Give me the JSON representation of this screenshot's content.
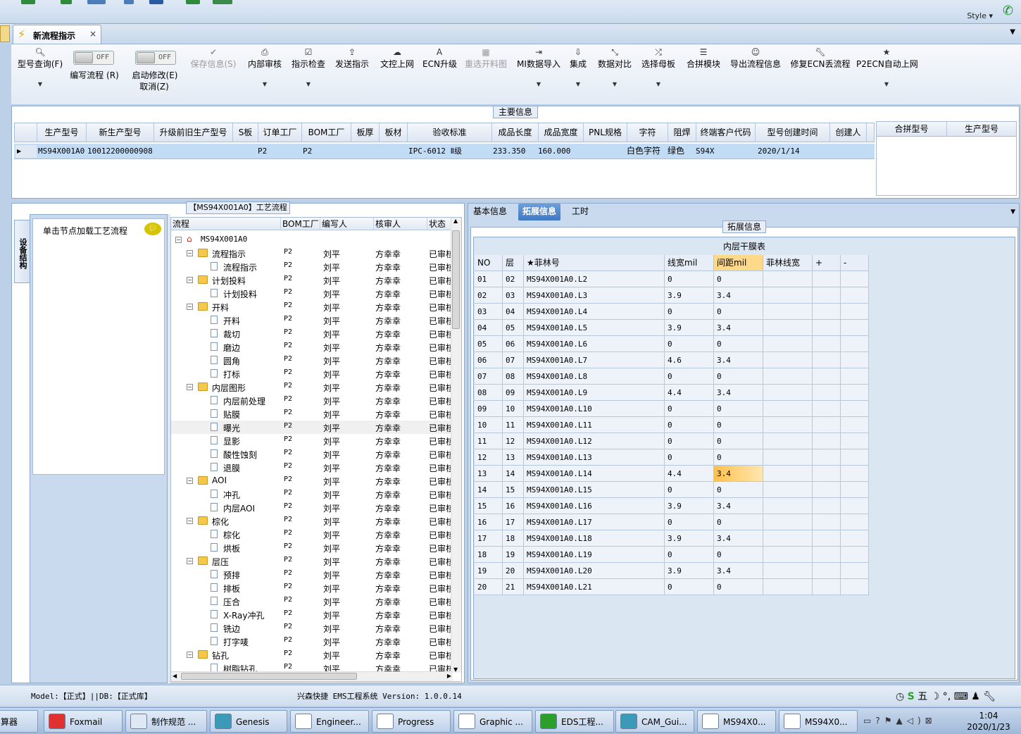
{
  "top": {
    "style_label": "Style"
  },
  "tab": {
    "title": "新流程指示",
    "close": "×"
  },
  "toolbar": {
    "items": [
      {
        "label": "型号查询(F)",
        "icon": "search-icon",
        "glyph": "🔍︎"
      },
      {
        "label": "编写流程 (R)",
        "icon": "toggle"
      },
      {
        "label": "启动修改(E)",
        "icon": "toggle"
      },
      {
        "label": "保存信息(S)",
        "icon": "check-icon",
        "glyph": "✔"
      },
      {
        "label": "内部审核",
        "icon": "printer-icon",
        "glyph": "⎙"
      },
      {
        "label": "指示检查",
        "icon": "checkbox-icon",
        "glyph": "☑"
      },
      {
        "label": "发送指示",
        "icon": "upload-icon",
        "glyph": "⇪"
      },
      {
        "label": "文控上网",
        "icon": "cloud-icon",
        "glyph": "☁"
      },
      {
        "label": "ECN升级",
        "icon": "font-icon",
        "glyph": "A"
      },
      {
        "label": "重选开料图",
        "icon": "image-icon",
        "glyph": "▦"
      },
      {
        "label": "MI数据导入",
        "icon": "import-icon",
        "glyph": "⇥"
      },
      {
        "label": "集成",
        "icon": "download-icon",
        "glyph": "⇩"
      },
      {
        "label": "数据对比",
        "icon": "compress-icon",
        "glyph": "⤡"
      },
      {
        "label": "选择母板",
        "icon": "shuffle-icon",
        "glyph": "⤮"
      },
      {
        "label": "合拼模块",
        "icon": "list-icon",
        "glyph": "☰"
      },
      {
        "label": "导出流程信息",
        "icon": "smile-icon",
        "glyph": "☺"
      },
      {
        "label": "修复ECN丢流程",
        "icon": "wrench-icon",
        "glyph": "🔧︎"
      },
      {
        "label": "P2ECN自动上网",
        "icon": "star-icon",
        "glyph": "★"
      }
    ],
    "toggle_off": "OFF",
    "cancel_label": "取消(Z)"
  },
  "main_info": {
    "title": "主要信息",
    "columns": [
      "生产型号",
      "新生产型号",
      "升级前旧生产型号",
      "S板",
      "订单工厂",
      "BOM工厂",
      "板厚",
      "板材",
      "验收标准",
      "成品长度",
      "成品宽度",
      "PNL规格",
      "字符",
      "阻焊",
      "终端客户代码",
      "型号创建时间",
      "创建人"
    ],
    "row": {
      "生产型号": "MS94X001A0",
      "新生产型号": "10012200000908",
      "订单工厂": "P2",
      "BOM工厂": "P2",
      "验收标准": "IPC-6012 Ⅱ级",
      "成品长度": "233.350",
      "成品宽度": "160.000",
      "字符": "白色字符",
      "阻焊": "绿色",
      "终端客户代码": "S94X",
      "型号创建时间": "2020/1/14"
    },
    "merge_columns": [
      "合拼型号",
      "生产型号"
    ]
  },
  "left_panel": {
    "title": "【MS94X001A0】工艺流程",
    "vertical_tab": "设备结构",
    "load_hint": "单击节点加载工艺流程",
    "tree_columns": [
      "流程",
      "BOM工厂",
      "编写人",
      "核审人",
      "状态"
    ],
    "root": "MS94X001A0",
    "rows": [
      {
        "name": "流程指示",
        "lvl": 1
      },
      {
        "name": "流程指示",
        "lvl": 2
      },
      {
        "name": "计划投料",
        "lvl": 1
      },
      {
        "name": "计划投料",
        "lvl": 2
      },
      {
        "name": "开料",
        "lvl": 1
      },
      {
        "name": "开料",
        "lvl": 2
      },
      {
        "name": "裁切",
        "lvl": 2
      },
      {
        "name": "磨边",
        "lvl": 2
      },
      {
        "name": "圆角",
        "lvl": 2
      },
      {
        "name": "打标",
        "lvl": 2
      },
      {
        "name": "内层图形",
        "lvl": 1
      },
      {
        "name": "内层前处理",
        "lvl": 2
      },
      {
        "name": "贴膜",
        "lvl": 2
      },
      {
        "name": "曝光",
        "lvl": 2
      },
      {
        "name": "显影",
        "lvl": 2
      },
      {
        "name": "酸性蚀刻",
        "lvl": 2
      },
      {
        "name": "退膜",
        "lvl": 2
      },
      {
        "name": "AOI",
        "lvl": 1
      },
      {
        "name": "冲孔",
        "lvl": 2
      },
      {
        "name": "内层AOI",
        "lvl": 2
      },
      {
        "name": "棕化",
        "lvl": 1
      },
      {
        "name": "棕化",
        "lvl": 2
      },
      {
        "name": "烘板",
        "lvl": 2
      },
      {
        "name": "层压",
        "lvl": 1
      },
      {
        "name": "预排",
        "lvl": 2
      },
      {
        "name": "排板",
        "lvl": 2
      },
      {
        "name": "压合",
        "lvl": 2
      },
      {
        "name": "X-Ray冲孔",
        "lvl": 2
      },
      {
        "name": "铣边",
        "lvl": 2
      },
      {
        "name": "打字唛",
        "lvl": 2
      },
      {
        "name": "钻孔",
        "lvl": 1
      },
      {
        "name": "树脂钻孔",
        "lvl": 2
      }
    ],
    "bom": "P2",
    "writer": "刘平",
    "reviewer": "方幸幸",
    "status": "已审核"
  },
  "right_panel": {
    "tabs": [
      "基本信息",
      "拓展信息",
      "工时"
    ],
    "section_title": "拓展信息",
    "table_title": "内层干膜表",
    "columns": [
      "NO",
      "层",
      "★菲林号",
      "线宽mil",
      "间距mil",
      "菲林线宽",
      "+",
      "-"
    ],
    "rows": [
      [
        "01",
        "02",
        "MS94X001A0.L2",
        "0",
        "0"
      ],
      [
        "02",
        "03",
        "MS94X001A0.L3",
        "3.9",
        "3.4"
      ],
      [
        "03",
        "04",
        "MS94X001A0.L4",
        "0",
        "0"
      ],
      [
        "04",
        "05",
        "MS94X001A0.L5",
        "3.9",
        "3.4"
      ],
      [
        "05",
        "06",
        "MS94X001A0.L6",
        "0",
        "0"
      ],
      [
        "06",
        "07",
        "MS94X001A0.L7",
        "4.6",
        "3.4"
      ],
      [
        "07",
        "08",
        "MS94X001A0.L8",
        "0",
        "0"
      ],
      [
        "08",
        "09",
        "MS94X001A0.L9",
        "4.4",
        "3.4"
      ],
      [
        "09",
        "10",
        "MS94X001A0.L10",
        "0",
        "0"
      ],
      [
        "10",
        "11",
        "MS94X001A0.L11",
        "0",
        "0"
      ],
      [
        "11",
        "12",
        "MS94X001A0.L12",
        "0",
        "0"
      ],
      [
        "12",
        "13",
        "MS94X001A0.L13",
        "0",
        "0"
      ],
      [
        "13",
        "14",
        "MS94X001A0.L14",
        "4.4",
        "3.4"
      ],
      [
        "14",
        "15",
        "MS94X001A0.L15",
        "0",
        "0"
      ],
      [
        "15",
        "16",
        "MS94X001A0.L16",
        "3.9",
        "3.4"
      ],
      [
        "16",
        "17",
        "MS94X001A0.L17",
        "0",
        "0"
      ],
      [
        "17",
        "18",
        "MS94X001A0.L18",
        "3.9",
        "3.4"
      ],
      [
        "18",
        "19",
        "MS94X001A0.L19",
        "0",
        "0"
      ],
      [
        "19",
        "20",
        "MS94X001A0.L20",
        "3.9",
        "3.4"
      ],
      [
        "20",
        "21",
        "MS94X001A0.L21",
        "0",
        "0"
      ]
    ],
    "highlight_row": 12
  },
  "status": {
    "left": "Model:【正式】||DB:【正式库】",
    "mid": "兴森快捷 EMS工程系统 Version: 1.0.0.14",
    "ime": "五"
  },
  "taskbar": {
    "items": [
      "算器",
      "Foxmail",
      "制作规范 ...",
      "Genesis",
      "Engineer...",
      "Progress",
      "Graphic ...",
      "EDS工程...",
      "CAM_Gui...",
      "MS94X0...",
      "MS94X0..."
    ],
    "time": "1:04",
    "date": "2020/1/23"
  },
  "colors": {
    "accent": "#3f78c4",
    "selection": "#c2dcf6",
    "highlight_cell": "#ffcf70",
    "panel_bg": "#c9d9ee"
  }
}
